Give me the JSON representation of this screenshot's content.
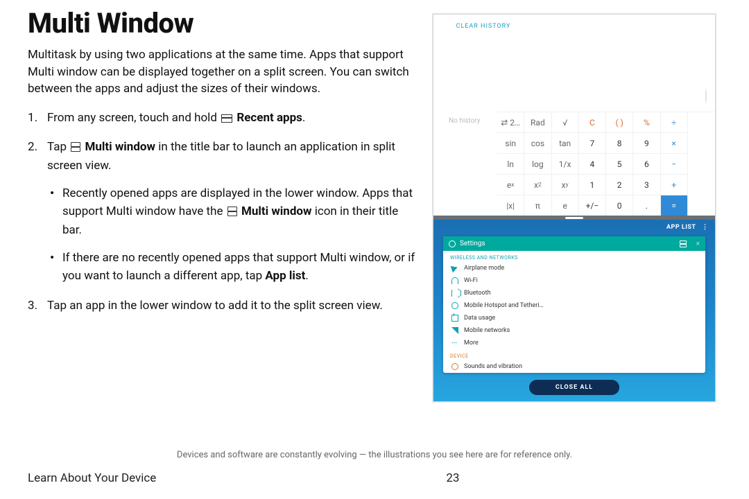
{
  "title": "Multi Window",
  "intro": "Multitask by using two applications at the same time. Apps that support Multi window can be displayed together on a split screen. You can switch between the apps and adjust the sizes of their windows.",
  "step1": {
    "pre": "From any screen, touch and hold ",
    "bold": "Recent apps",
    "post": "."
  },
  "step2": {
    "pre": "Tap ",
    "bold": "Multi window",
    "post": " in the title bar to launch an application in split screen view."
  },
  "bullet1": {
    "a": "Recently opened apps are displayed in the lower window. Apps that support Multi window have the ",
    "bold": "Multi window",
    "c": " icon in their title bar."
  },
  "bullet2": {
    "a": "If there are no recently opened apps that support Multi window, or if you want to launch a different app, tap ",
    "bold": "App list",
    "c": "."
  },
  "step3": "Tap an app in the lower window to add it to the split screen view.",
  "device": {
    "clear_history": "CLEAR HISTORY",
    "no_history": "No history",
    "calc": {
      "r1": [
        "⇄ 2…",
        "Rad",
        "√",
        "C",
        "( )",
        "%",
        "÷"
      ],
      "r2": [
        "sin",
        "cos",
        "tan",
        "7",
        "8",
        "9",
        "×"
      ],
      "r3": [
        "ln",
        "log",
        "1/x",
        "4",
        "5",
        "6",
        "−"
      ],
      "r4_labels": [
        "e^x",
        "x^2",
        "x^y",
        "1",
        "2",
        "3",
        "+"
      ],
      "r5": [
        "|x|",
        "π",
        "e",
        "+/−",
        "0",
        ".",
        "="
      ]
    },
    "app_list": "APP LIST",
    "card_title": "Settings",
    "sect_wireless": "WIRELESS AND NETWORKS",
    "rows": [
      "Airplane mode",
      "Wi-Fi",
      "Bluetooth",
      "Mobile Hotspot and Tetheri…",
      "Data usage",
      "Mobile networks",
      "More"
    ],
    "sect_device": "DEVICE",
    "row_device": "Sounds and vibration",
    "close_all": "CLOSE ALL"
  },
  "disclaimer": "Devices and software are constantly evolving — the illustrations you see here are for reference only.",
  "footer_left": "Learn About Your Device",
  "footer_page": "23"
}
